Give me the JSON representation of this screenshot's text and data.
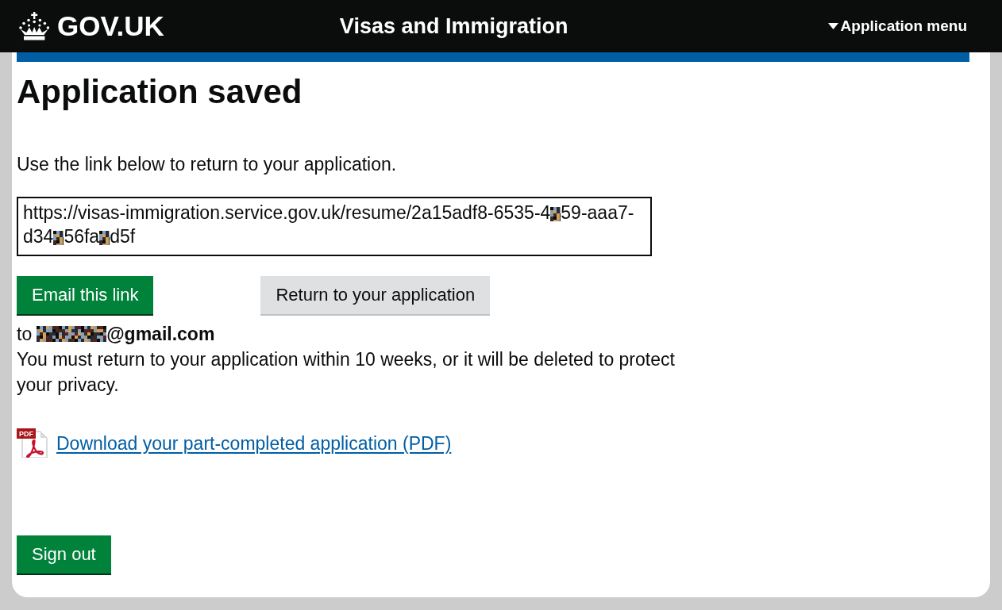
{
  "header": {
    "logo_text": "GOV.UK",
    "service_name": "Visas and Immigration",
    "menu_label": "Application menu"
  },
  "main": {
    "title": "Application saved",
    "intro": "Use the link below to return to your application.",
    "resume_link": {
      "visible_parts": [
        "https://visas-immigration.service.gov.uk/resume/2a15adf8-6535-4",
        "59-aaa7-d34",
        "56fa",
        "d5f"
      ]
    },
    "buttons": [
      {
        "label": "Email this link",
        "kind": "primary"
      },
      {
        "label": "Return to your application",
        "kind": "secondary"
      }
    ],
    "email_recipient": {
      "prefix": "to",
      "address_visible_part": "@gmail.com"
    },
    "notice": "You must return to your application within 10 weeks, or it will be deleted to protect your privacy.",
    "download": {
      "icon_text": "PDF",
      "link_text": "Download your part-completed application (PDF)"
    },
    "sign_out": {
      "label": "Sign out",
      "kind": "primary"
    }
  }
}
